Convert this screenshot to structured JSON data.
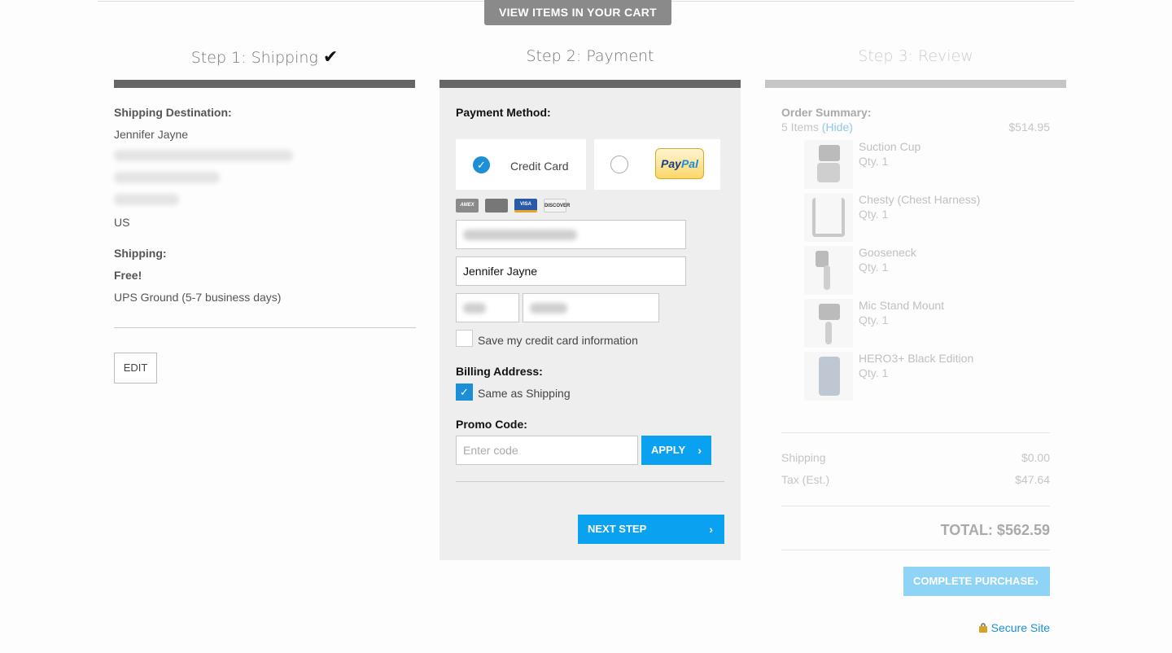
{
  "header": {
    "view_cart_label": "VIEW ITEMS IN YOUR CART"
  },
  "steps": [
    {
      "label": "Step 1: Shipping",
      "complete": true
    },
    {
      "label": "Step 2: Payment",
      "complete": false
    },
    {
      "label": "Step 3: Review",
      "complete": false
    }
  ],
  "shipping": {
    "destination_label": "Shipping Destination:",
    "name": "Jennifer Jayne",
    "country": "US",
    "method_label": "Shipping:",
    "cost": "Free!",
    "method": "UPS Ground (5-7 business days)",
    "edit_label": "EDIT"
  },
  "payment": {
    "method_label": "Payment Method:",
    "credit_card_label": "Credit Card",
    "credit_card_selected": true,
    "paypal_label": [
      "Pay",
      "Pal"
    ],
    "card_types": [
      "AMEX",
      "MC",
      "VISA",
      "DISCOVER"
    ],
    "cardholder_name": "Jennifer Jayne",
    "save_card_label": "Save my credit card information",
    "save_card_checked": false,
    "billing_label": "Billing Address:",
    "same_as_shipping_label": "Same as Shipping",
    "same_as_shipping_checked": true,
    "promo_label": "Promo Code:",
    "promo_placeholder": "Enter code",
    "apply_label": "APPLY",
    "next_label": "NEXT STEP"
  },
  "summary": {
    "label": "Order Summary:",
    "items_count": "5 Items",
    "hide_label": "(Hide)",
    "items_total": "$514.95",
    "items": [
      {
        "name": "Suction Cup",
        "qty": "Qty. 1"
      },
      {
        "name": "Chesty (Chest Harness)",
        "qty": "Qty. 1"
      },
      {
        "name": "Gooseneck",
        "qty": "Qty. 1"
      },
      {
        "name": "Mic Stand Mount",
        "qty": "Qty. 1"
      },
      {
        "name": "HERO3+ Black Edition",
        "qty": "Qty. 1"
      }
    ],
    "shipping_label": "Shipping",
    "shipping_value": "$0.00",
    "tax_label": "Tax (Est.)",
    "tax_value": "$47.64",
    "total": "TOTAL: $562.59",
    "complete_label": "COMPLETE PURCHASE",
    "secure_label": "Secure Site"
  },
  "colors": {
    "accent": "#0aa2f0",
    "accent_disabled": "#8fd3f7",
    "step_active": "#666666",
    "step_inactive": "#c6c6c6"
  }
}
